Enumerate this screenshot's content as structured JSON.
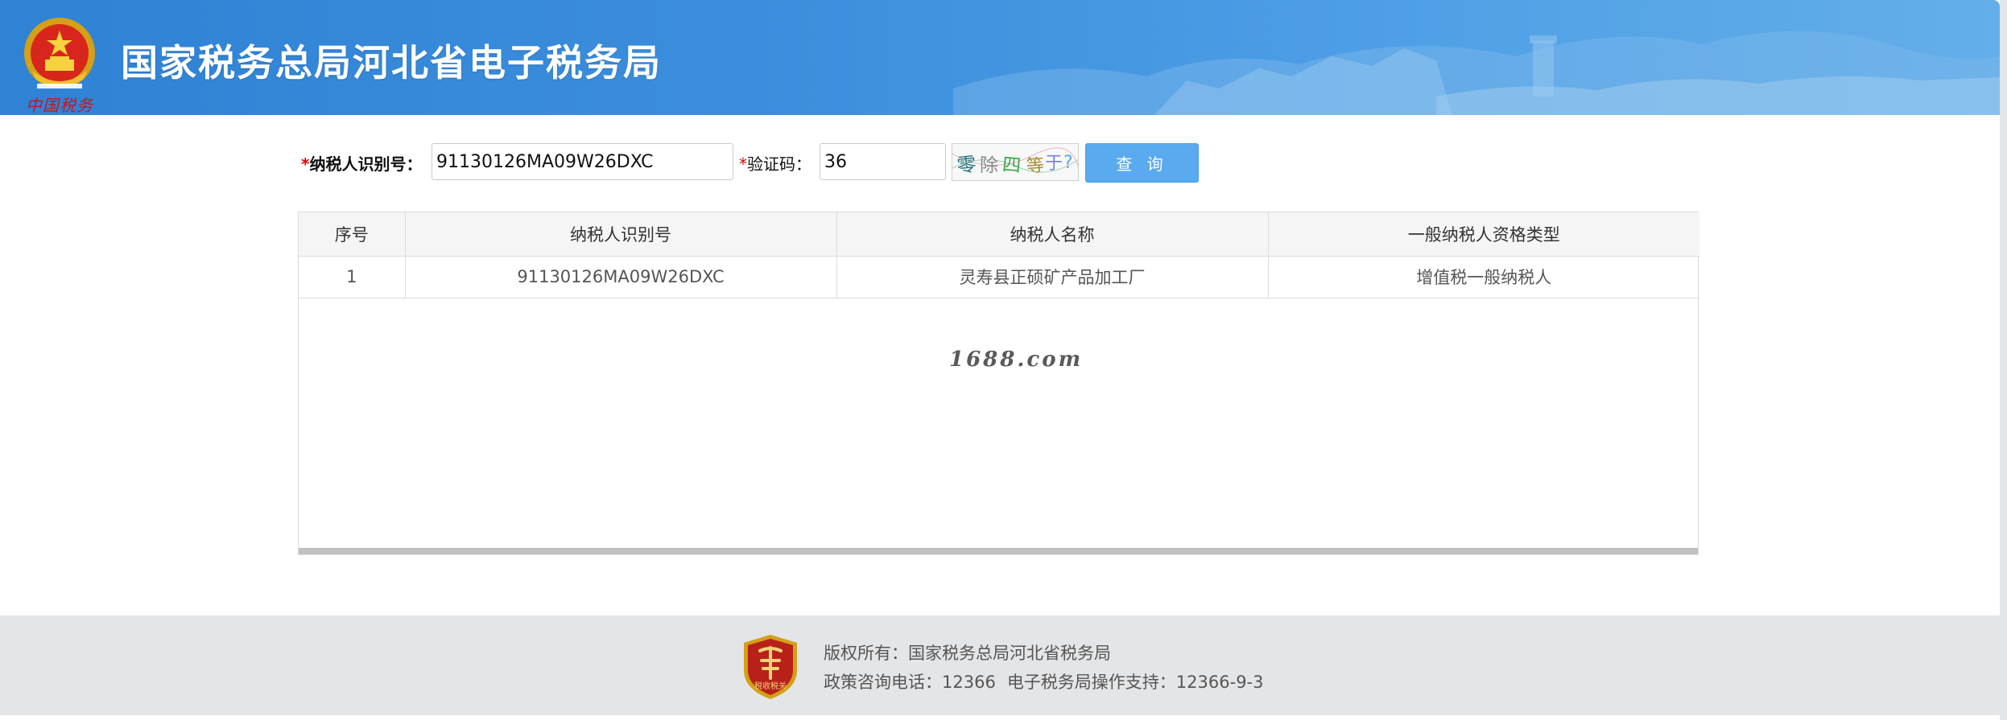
{
  "header": {
    "site_title": "国家税务总局河北省电子税务局",
    "brand_script": "中国税务"
  },
  "query": {
    "taxpayer_id_label": "纳税人识别号：",
    "taxpayer_id_value": "91130126MA09W26DXC",
    "captcha_label": "验证码：",
    "captcha_value": "36",
    "captcha_text": "零除四等于?",
    "required_mark": "*",
    "search_button_label": "查 询"
  },
  "results": {
    "columns": [
      "序号",
      "纳税人识别号",
      "纳税人名称",
      "一般纳税人资格类型"
    ],
    "rows": [
      [
        "1",
        "91130126MA09W26DXC",
        "灵寿县正硕矿产品加工厂",
        "增值税一般纳税人"
      ]
    ],
    "watermark": "1688.com"
  },
  "footer": {
    "copyright": "版权所有：国家税务总局河北省税务局",
    "hotline": "政策咨询电话：12366",
    "support": "电子税务局操作支持：12366-9-3",
    "badge_text": "税收税关"
  },
  "colors": {
    "header_blue": "#3d8fdd",
    "button_blue": "#5aaaf0",
    "required_red": "#e00000",
    "footer_gray": "#e4e5e7"
  }
}
